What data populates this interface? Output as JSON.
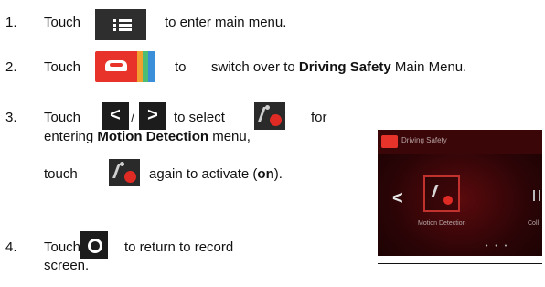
{
  "steps": {
    "s1": {
      "num": "1.",
      "touch": "Touch",
      "rest": "to enter main menu."
    },
    "s2": {
      "num": "2.",
      "touch": "Touch",
      "to": "to",
      "pre": "switch over to",
      "bold": "Driving Safety",
      "post": "Main Menu."
    },
    "s3": {
      "num": "3.",
      "touch": "Touch",
      "slash": "/",
      "to_select": "to select",
      "for": "for",
      "line2_pre": "entering",
      "line2_bold": "Motion Detection",
      "line2_post": "menu,",
      "touch2": "touch",
      "again": "again to activate (",
      "on": "on",
      "end": ")."
    },
    "s4": {
      "num": "4.",
      "touch": "Touch",
      "rest": "to return to record",
      "line2": "screen."
    }
  },
  "icons": {
    "menu": "list-menu-icon",
    "driving_safety": "car-icon",
    "prev": "chevron-left-icon",
    "next": "chevron-right-icon",
    "motion": "motion-detection-icon",
    "record": "record-icon"
  },
  "nav_glyphs": {
    "prev": "<",
    "next": ">"
  },
  "device": {
    "header_title": "Driving Safety",
    "chevron": "<",
    "tile_label": "Motion Detection",
    "next_label": "Coll",
    "pager": "• • •"
  },
  "colors": {
    "accent_red": "#e8332b",
    "orange": "#f2a02f",
    "green": "#4dbd74",
    "blue": "#3a8fd8"
  }
}
